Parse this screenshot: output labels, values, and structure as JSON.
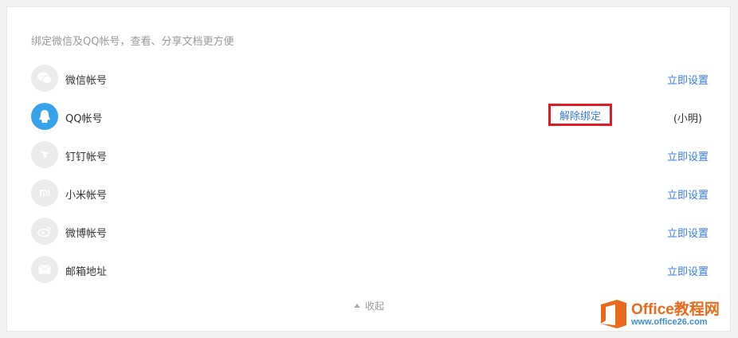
{
  "description": "绑定微信及QQ帐号，查看、分享文档更方便",
  "accounts": [
    {
      "label": "微信帐号",
      "icon": "wechat-icon",
      "action": "立即设置"
    },
    {
      "label": "QQ帐号",
      "icon": "qq-icon",
      "bound_name": "(小明)",
      "unbind": "解除绑定"
    },
    {
      "label": "钉钉帐号",
      "icon": "dingtalk-icon",
      "action": "立即设置"
    },
    {
      "label": "小米帐号",
      "icon": "xiaomi-icon",
      "action": "立即设置"
    },
    {
      "label": "微博帐号",
      "icon": "weibo-icon",
      "action": "立即设置"
    },
    {
      "label": "邮箱地址",
      "icon": "email-icon",
      "action": "立即设置"
    }
  ],
  "collapse_label": "收起",
  "watermark": {
    "title": "Office教程网",
    "url": "www.office26.com"
  },
  "colors": {
    "link": "#3a7bd5",
    "highlight_border": "#e01b24",
    "qq_blue": "#36a3e8",
    "icon_bg": "#ebebeb"
  }
}
